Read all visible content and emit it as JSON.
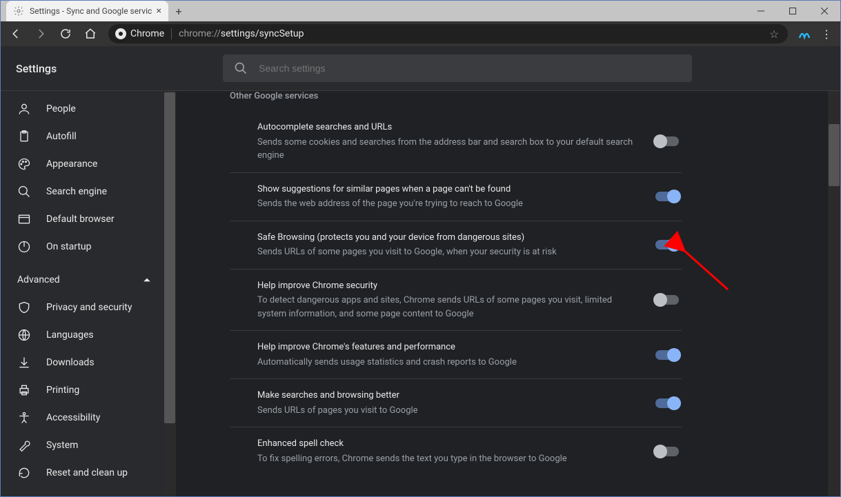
{
  "window": {
    "tab_title": "Settings - Sync and Google servic"
  },
  "toolbar": {
    "chrome_chip": "Chrome",
    "url_prefix": "chrome://",
    "url_path": "settings/syncSetup"
  },
  "header": {
    "title": "Settings",
    "search_placeholder": "Search settings"
  },
  "sidebar": {
    "items": [
      {
        "label": "People"
      },
      {
        "label": "Autofill"
      },
      {
        "label": "Appearance"
      },
      {
        "label": "Search engine"
      },
      {
        "label": "Default browser"
      },
      {
        "label": "On startup"
      }
    ],
    "advanced_label": "Advanced",
    "adv_items": [
      {
        "label": "Privacy and security"
      },
      {
        "label": "Languages"
      },
      {
        "label": "Downloads"
      },
      {
        "label": "Printing"
      },
      {
        "label": "Accessibility"
      },
      {
        "label": "System"
      },
      {
        "label": "Reset and clean up"
      }
    ]
  },
  "main": {
    "section_title": "Other Google services",
    "rows": [
      {
        "title": "Autocomplete searches and URLs",
        "sub": "Sends some cookies and searches from the address bar and search box to your default search engine",
        "on": false
      },
      {
        "title": "Show suggestions for similar pages when a page can't be found",
        "sub": "Sends the web address of the page you're trying to reach to Google",
        "on": true
      },
      {
        "title": "Safe Browsing (protects you and your device from dangerous sites)",
        "sub": "Sends URLs of some pages you visit to Google, when your security is at risk",
        "on": true
      },
      {
        "title": "Help improve Chrome security",
        "sub": "To detect dangerous apps and sites, Chrome sends URLs of some pages you visit, limited system information, and some page content to Google",
        "on": false
      },
      {
        "title": "Help improve Chrome's features and performance",
        "sub": "Automatically sends usage statistics and crash reports to Google",
        "on": true
      },
      {
        "title": "Make searches and browsing better",
        "sub": "Sends URLs of pages you visit to Google",
        "on": true
      },
      {
        "title": "Enhanced spell check",
        "sub": "To fix spelling errors, Chrome sends the text you type in the browser to Google",
        "on": false
      }
    ]
  }
}
